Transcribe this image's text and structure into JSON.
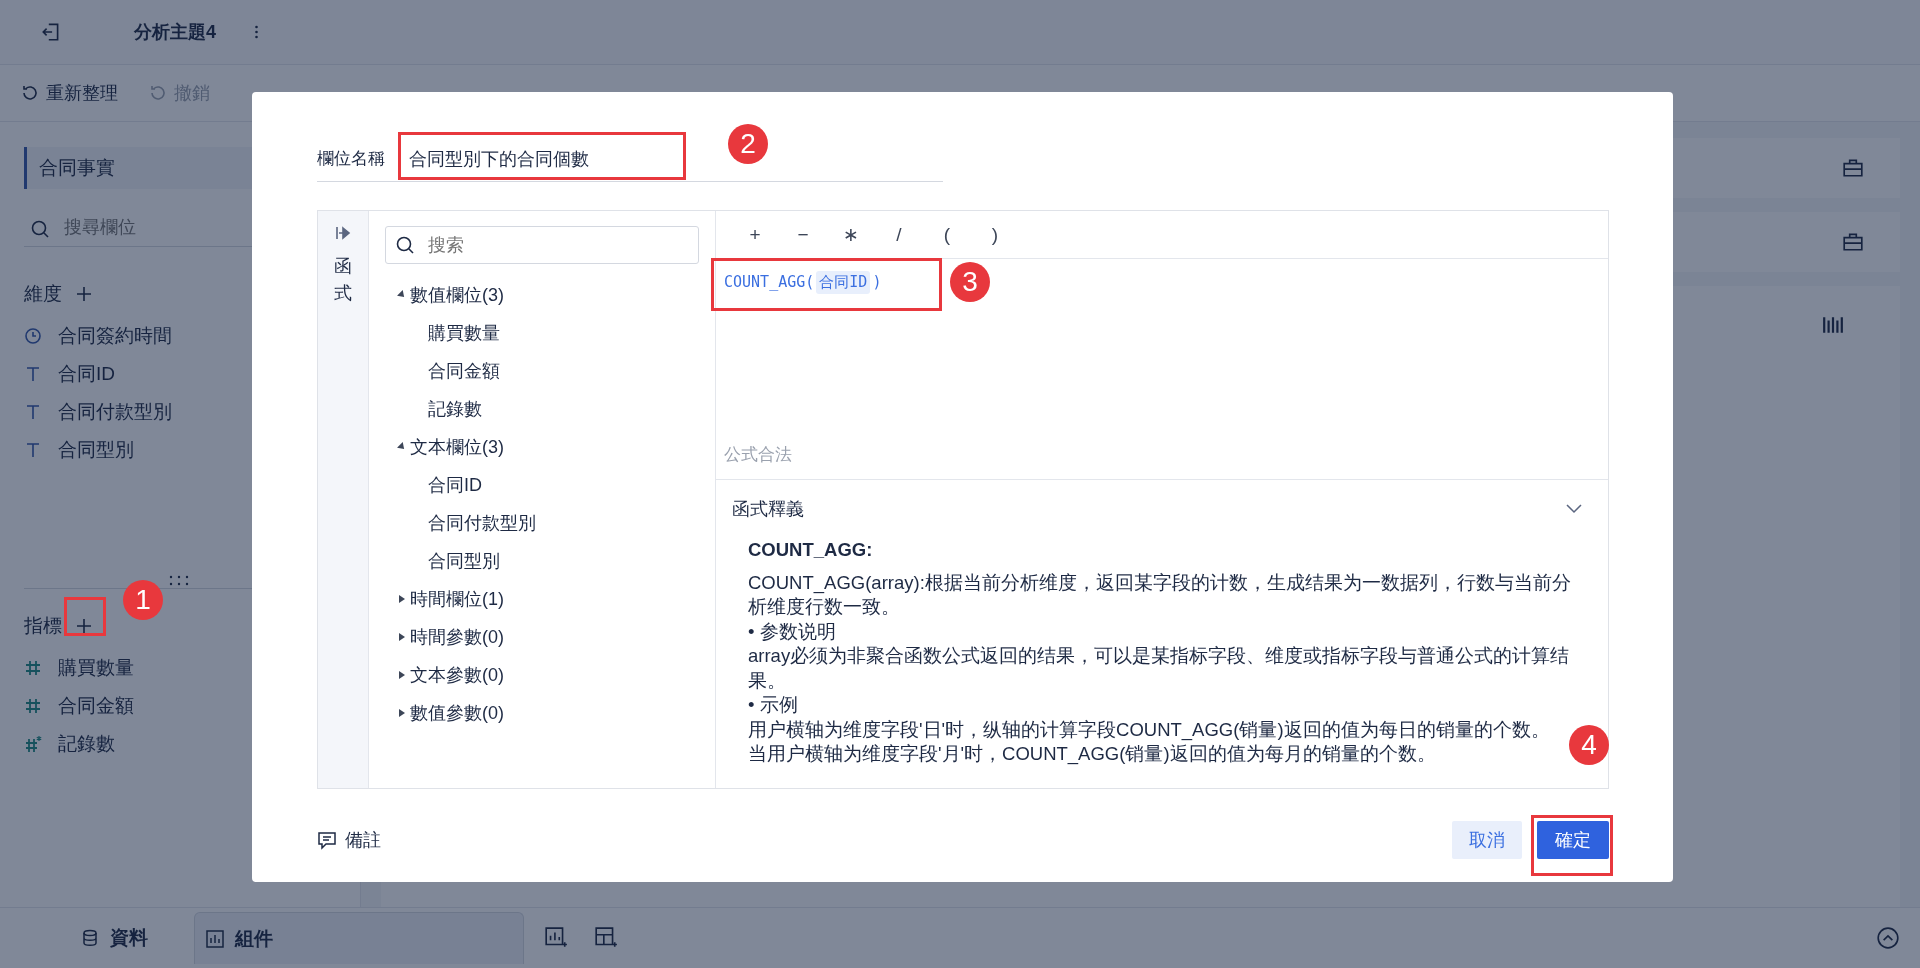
{
  "topbar": {
    "title": "分析主題4"
  },
  "toolbar": [
    {
      "label": "重新整理",
      "disabled": false
    },
    {
      "label": "撤銷",
      "disabled": true
    }
  ],
  "sidebar": {
    "table": "合同事實",
    "search_placeholder": "搜尋欄位",
    "dimensions": {
      "title": "維度",
      "items": [
        {
          "name": "合同簽約時間",
          "kind": "time"
        },
        {
          "name": "合同ID",
          "kind": "text"
        },
        {
          "name": "合同付款型別",
          "kind": "text"
        },
        {
          "name": "合同型別",
          "kind": "text"
        }
      ]
    },
    "measures": {
      "title": "指標",
      "items": [
        {
          "name": "購買數量",
          "kind": "number"
        },
        {
          "name": "合同金額",
          "kind": "number"
        },
        {
          "name": "記錄數",
          "kind": "count"
        }
      ]
    }
  },
  "bottom_tabs": [
    {
      "label": "資料",
      "kind": "database",
      "selected": false
    },
    {
      "label": "組件",
      "kind": "chart",
      "selected": true
    }
  ],
  "dialog": {
    "field_label": "欄位名稱",
    "field_value": "合同型別下的合同個數",
    "side_tab": "函式",
    "search_placeholder": "搜索",
    "tree": [
      {
        "label": "數值欄位(3)",
        "expanded": true,
        "children": [
          {
            "label": "購買數量"
          },
          {
            "label": "合同金額"
          },
          {
            "label": "記錄數"
          }
        ]
      },
      {
        "label": "文本欄位(3)",
        "expanded": true,
        "children": [
          {
            "label": "合同ID"
          },
          {
            "label": "合同付款型別"
          },
          {
            "label": "合同型別"
          }
        ]
      },
      {
        "label": "時間欄位(1)",
        "expanded": false
      },
      {
        "label": "時間參數(0)",
        "expanded": false
      },
      {
        "label": "文本參數(0)",
        "expanded": false
      },
      {
        "label": "數值參數(0)",
        "expanded": false
      }
    ],
    "operators": [
      "+",
      "−",
      "∗",
      "/",
      "(",
      ")"
    ],
    "formula": {
      "function": "COUNT_AGG(",
      "argument": "合同ID",
      "close": ")"
    },
    "status": "公式合法",
    "explain": {
      "title": "函式釋義",
      "name": "COUNT_AGG:",
      "paragraphs": [
        "COUNT_AGG(array):根据当前分析维度，返回某字段的计数，生成结果为一数据列，行数与当前分析维度行数一致。",
        "• 参数说明",
        "array必须为非聚合函数公式返回的结果，可以是某指标字段、维度或指标字段与普通公式的计算结果。",
        "• 示例",
        "用户横轴为维度字段'日'时，纵轴的计算字段COUNT_AGG(销量)返回的值为每日的销量的个数。",
        "当用户横轴为维度字段'月'时，COUNT_AGG(销量)返回的值为每月的销量的个数。"
      ]
    },
    "note": "備註",
    "cancel": "取消",
    "confirm": "確定"
  },
  "annotations": [
    {
      "number": "1"
    },
    {
      "number": "2"
    },
    {
      "number": "3"
    },
    {
      "number": "4"
    }
  ]
}
